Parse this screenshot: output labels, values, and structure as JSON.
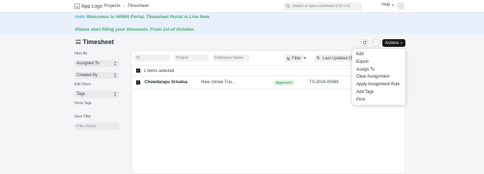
{
  "navbar": {
    "logo_alt": "App Logo",
    "breadcrumbs": [
      "Projects",
      "Timesheet"
    ],
    "search_placeholder": "Search or type a command (Ctrl + G)",
    "help_label": "Help"
  },
  "banner": {
    "hello": "Hello",
    "welcome_prefix": "Welcomes to HRMS Portal,",
    "welcome_italic": "Timesheet Portal is Live Now.",
    "line2": "Please start filling your timeseets. From 1st of October."
  },
  "header": {
    "title": "Timesheet",
    "actions_label": "Actions",
    "more_label": "···"
  },
  "sidebar": {
    "filter_by_label": "Filter By",
    "assigned_to": "Assigned To",
    "created_by": "Created By",
    "edit_filters": "Edit Filters",
    "tags": "Tags",
    "show_tags": "Show Tags",
    "save_filter": "Save Filter",
    "filter_name_placeholder": "Filter Name"
  },
  "filters": {
    "id_placeholder": "ID",
    "project_placeholder": "Project",
    "employee_placeholder": "Employee Name",
    "filter_label": "Filter",
    "sort_label": "Last Updated On"
  },
  "list": {
    "selected_text": "1 items selected",
    "rows": [
      {
        "employee": "Chowdarapu Srivatsa",
        "project": "New Joinee Trai...",
        "status": "Approved",
        "id": "TS-2024-00069"
      }
    ]
  },
  "actions_menu": {
    "items": [
      "Edit",
      "Export",
      "Assign To",
      "Clear Assignment",
      "Apply Assignment Rule",
      "Add Tags",
      "Print"
    ]
  },
  "colors": {
    "accent": "#2490ef",
    "banner_text": "#46a86f",
    "approved_bg": "#e4f5e9",
    "approved_text": "#2f8f4e"
  }
}
